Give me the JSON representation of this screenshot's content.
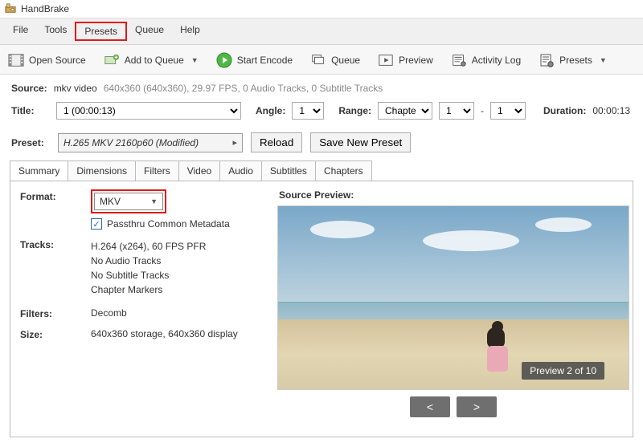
{
  "app": {
    "name": "HandBrake"
  },
  "menu": {
    "file": "File",
    "tools": "Tools",
    "presets": "Presets",
    "queue": "Queue",
    "help": "Help"
  },
  "toolbar": {
    "open_source": "Open Source",
    "add_to_queue": "Add to Queue",
    "start_encode": "Start Encode",
    "queue": "Queue",
    "preview": "Preview",
    "activity_log": "Activity Log",
    "presets": "Presets"
  },
  "meta": {
    "source_label": "Source:",
    "source_value": "mkv video",
    "source_detail": "640x360 (640x360), 29.97 FPS, 0 Audio Tracks, 0 Subtitle Tracks",
    "title_label": "Title:",
    "title_value": "1  (00:00:13)",
    "angle_label": "Angle:",
    "angle_value": "1",
    "range_label": "Range:",
    "range_type": "Chapters",
    "range_from": "1",
    "range_dash": "-",
    "range_to": "1",
    "duration_label": "Duration:",
    "duration_value": "00:00:13"
  },
  "preset": {
    "label": "Preset:",
    "value": "H.265 MKV 2160p60  (Modified)",
    "reload": "Reload",
    "save_new": "Save New Preset"
  },
  "tabs": {
    "summary": "Summary",
    "dimensions": "Dimensions",
    "filters": "Filters",
    "video": "Video",
    "audio": "Audio",
    "subtitles": "Subtitles",
    "chapters": "Chapters"
  },
  "summary": {
    "format_label": "Format:",
    "format_value": "MKV",
    "passthru": "Passthru Common Metadata",
    "tracks_label": "Tracks:",
    "tracks": {
      "l1": "H.264 (x264), 60 FPS PFR",
      "l2": "No Audio Tracks",
      "l3": "No Subtitle Tracks",
      "l4": "Chapter Markers"
    },
    "filters_label": "Filters:",
    "filters_value": "Decomb",
    "size_label": "Size:",
    "size_value": "640x360 storage, 640x360 display"
  },
  "preview": {
    "label": "Source Preview:",
    "badge": "Preview 2 of 10",
    "prev": "<",
    "next": ">"
  }
}
